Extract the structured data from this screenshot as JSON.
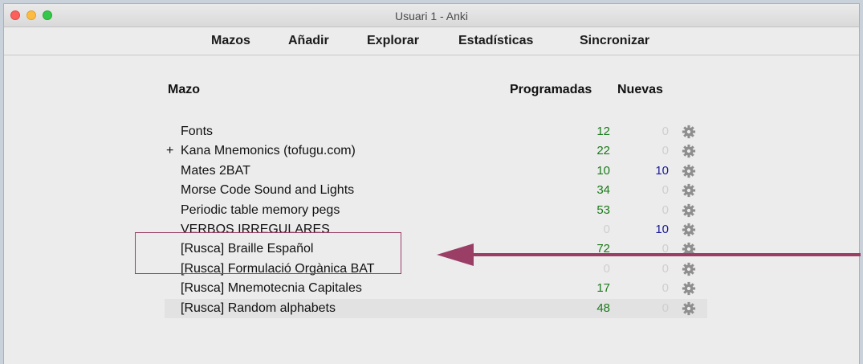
{
  "window": {
    "title": "Usuari 1 - Anki"
  },
  "toolbar": {
    "items": [
      "Mazos",
      "Añadir",
      "Explorar",
      "Estadísticas",
      "Sincronizar"
    ]
  },
  "table": {
    "headers": {
      "deck": "Mazo",
      "due": "Programadas",
      "new": "Nuevas"
    },
    "rows": [
      {
        "expander": "",
        "name": "Fonts",
        "due": "12",
        "new": "0"
      },
      {
        "expander": "+",
        "name": "Kana Mnemonics (tofugu.com)",
        "due": "22",
        "new": "0"
      },
      {
        "expander": "",
        "name": "Mates 2BAT",
        "due": "10",
        "new": "10"
      },
      {
        "expander": "",
        "name": "Morse Code Sound and Lights",
        "due": "34",
        "new": "0"
      },
      {
        "expander": "",
        "name": "Periodic table memory pegs",
        "due": "53",
        "new": "0"
      },
      {
        "expander": "",
        "name": "VERBOS IRREGULARES",
        "due": "0",
        "new": "10"
      },
      {
        "expander": "",
        "name": "[Rusca] Braille Español",
        "due": "72",
        "new": "0"
      },
      {
        "expander": "",
        "name": "[Rusca] Formulació Orgànica BAT",
        "due": "0",
        "new": "0"
      },
      {
        "expander": "",
        "name": "[Rusca] Mnemotecnia Capitales",
        "due": "17",
        "new": "0"
      },
      {
        "expander": "",
        "name": "[Rusca] Random alphabets",
        "due": "48",
        "new": "0"
      }
    ]
  },
  "colors": {
    "due": "#1b7a1b",
    "new": "#1a1a9a",
    "zero": "#cfcfcf",
    "annotation": "#9a3e66"
  },
  "icons": {
    "deck_options": "gear-icon"
  }
}
